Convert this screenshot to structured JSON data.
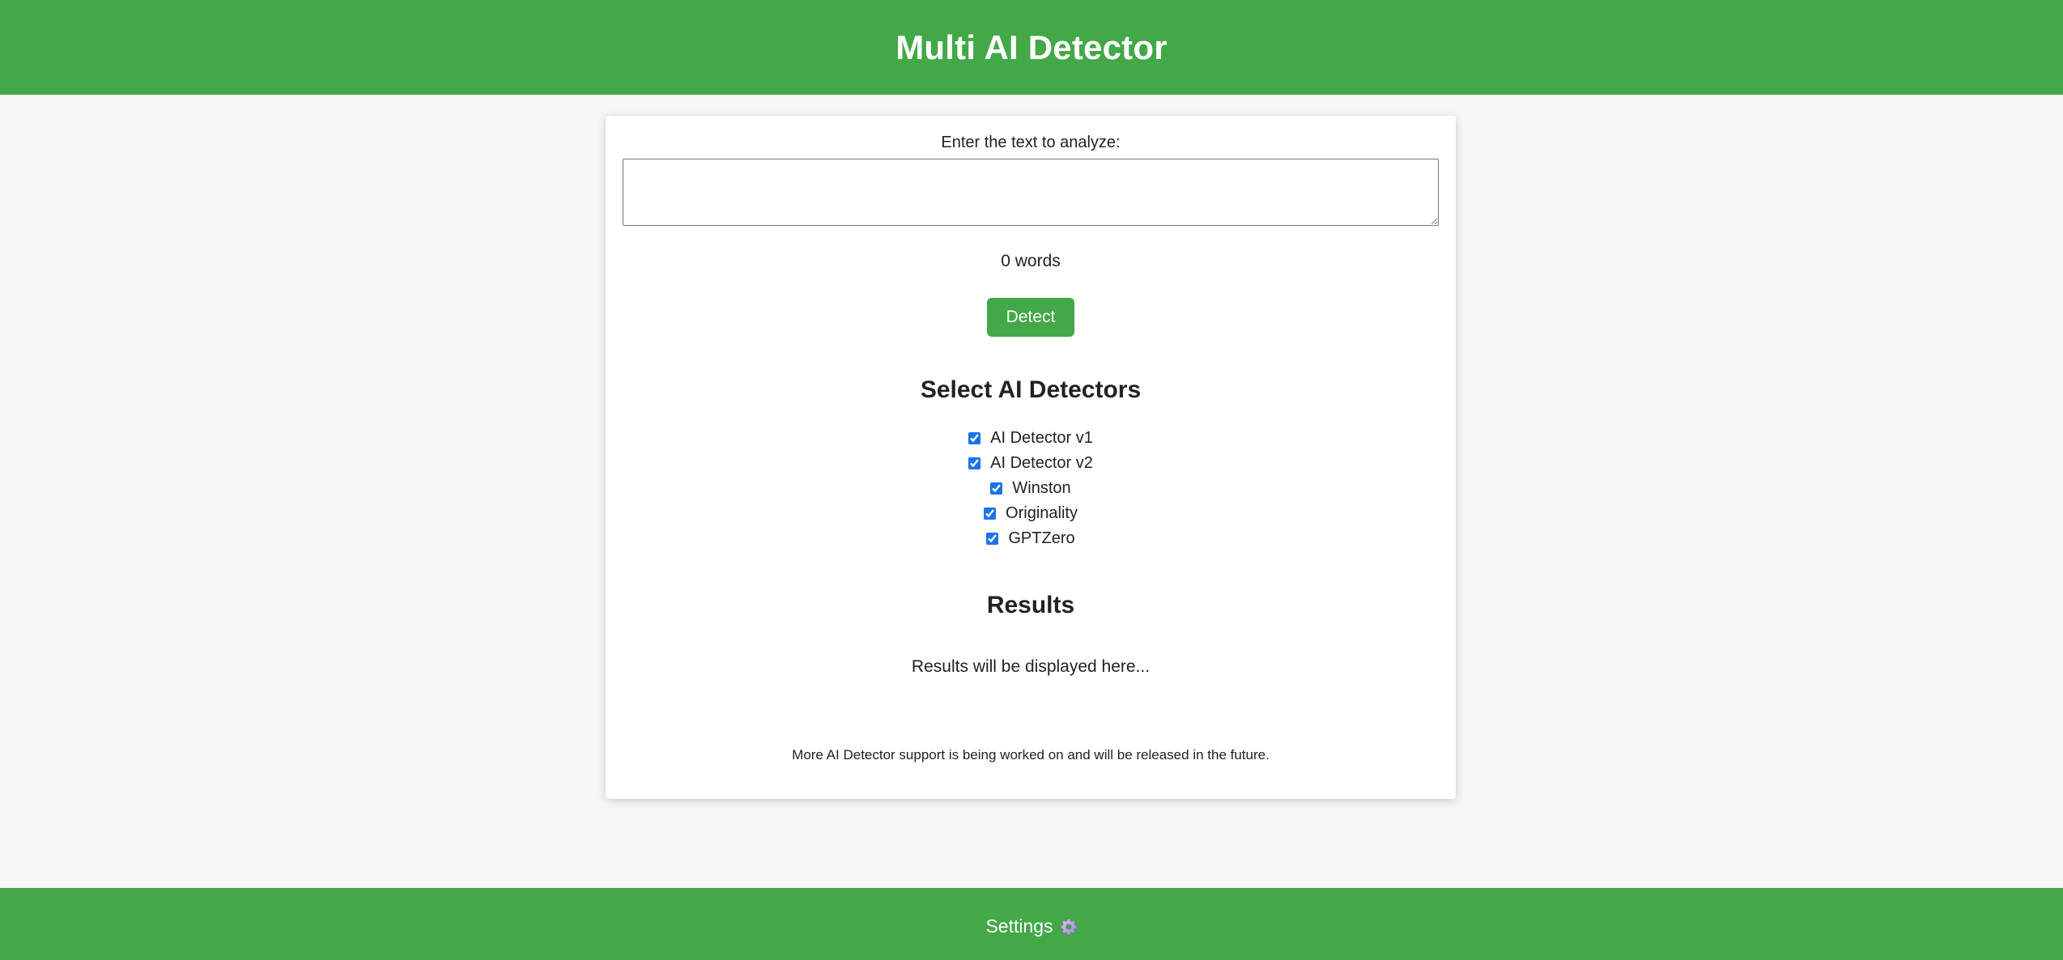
{
  "header": {
    "title": "Multi AI Detector"
  },
  "form": {
    "input_label": "Enter the text to analyze:",
    "textarea_value": "",
    "word_count": "0 words",
    "detect_label": "Detect"
  },
  "detectors": {
    "heading": "Select AI Detectors",
    "items": [
      {
        "label": "AI Detector v1",
        "checked": true
      },
      {
        "label": "AI Detector v2",
        "checked": true
      },
      {
        "label": "Winston",
        "checked": true
      },
      {
        "label": "Originality",
        "checked": true
      },
      {
        "label": "GPTZero",
        "checked": true
      }
    ]
  },
  "results": {
    "heading": "Results",
    "placeholder": "Results will be displayed here..."
  },
  "footnote": "More AI Detector support is being worked on and will be released in the future.",
  "footer": {
    "settings_label": "Settings",
    "settings_icon": "gear-icon"
  },
  "colors": {
    "brand_green": "#43a847",
    "background": "#f6f6f6",
    "checkbox_accent": "#1a73e8"
  }
}
